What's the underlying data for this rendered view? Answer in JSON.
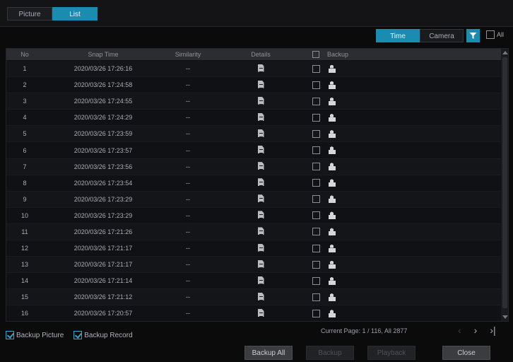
{
  "view_tabs": [
    "Picture",
    "List"
  ],
  "sort": {
    "time": "Time",
    "camera": "Camera",
    "all": "All"
  },
  "table": {
    "headers": {
      "no": "No",
      "time": "Snap Time",
      "similarity": "Similarity",
      "details": "Details",
      "backup": "Backup"
    },
    "rows": [
      {
        "no": "1",
        "time": "2020/03/26 17:26:16",
        "similarity": "--"
      },
      {
        "no": "2",
        "time": "2020/03/26 17:24:58",
        "similarity": "--"
      },
      {
        "no": "3",
        "time": "2020/03/26 17:24:55",
        "similarity": "--"
      },
      {
        "no": "4",
        "time": "2020/03/26 17:24:29",
        "similarity": "--"
      },
      {
        "no": "5",
        "time": "2020/03/26 17:23:59",
        "similarity": "--"
      },
      {
        "no": "6",
        "time": "2020/03/26 17:23:57",
        "similarity": "--"
      },
      {
        "no": "7",
        "time": "2020/03/26 17:23:56",
        "similarity": "--"
      },
      {
        "no": "8",
        "time": "2020/03/26 17:23:54",
        "similarity": "--"
      },
      {
        "no": "9",
        "time": "2020/03/26 17:23:29",
        "similarity": "--"
      },
      {
        "no": "10",
        "time": "2020/03/26 17:23:29",
        "similarity": "--"
      },
      {
        "no": "11",
        "time": "2020/03/26 17:21:26",
        "similarity": "--"
      },
      {
        "no": "12",
        "time": "2020/03/26 17:21:17",
        "similarity": "--"
      },
      {
        "no": "13",
        "time": "2020/03/26 17:21:17",
        "similarity": "--"
      },
      {
        "no": "14",
        "time": "2020/03/26 17:21:14",
        "similarity": "--"
      },
      {
        "no": "15",
        "time": "2020/03/26 17:21:12",
        "similarity": "--"
      },
      {
        "no": "16",
        "time": "2020/03/26 17:20:57",
        "similarity": "--"
      }
    ]
  },
  "footer": {
    "backup_picture": "Backup Picture",
    "backup_record": "Backup Record",
    "page_info": "Current Page: 1 / 116, All 2877"
  },
  "pager": {
    "next": "›",
    "last": "›|"
  },
  "actions": {
    "backup_all": "Backup All",
    "backup": "Backup",
    "playback": "Playback",
    "close": "Close"
  },
  "colors": {
    "accent": "#1a8cb0",
    "background": "#0b0b0c"
  }
}
